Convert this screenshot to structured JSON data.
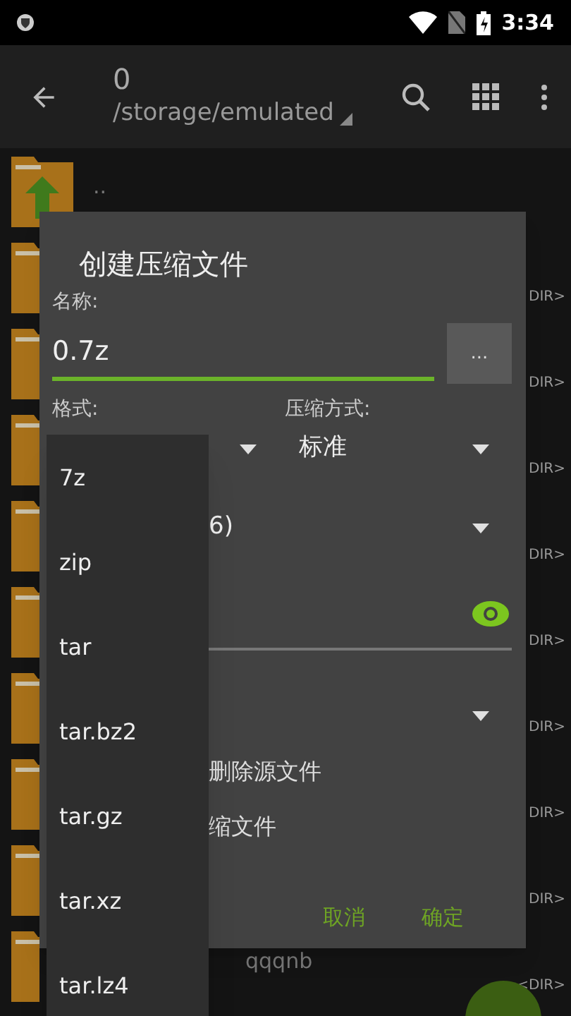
{
  "status_bar": {
    "time": "3:34"
  },
  "toolbar": {
    "title": "0",
    "path": "/storage/emulated"
  },
  "file_list": {
    "rows": [
      {
        "name": ".."
      },
      {
        "size": "DIR>"
      },
      {
        "size": "DIR>"
      },
      {
        "size": "DIR>"
      },
      {
        "size": "DIR>"
      },
      {
        "size": "DIR>"
      },
      {
        "size": "DIR>"
      },
      {
        "size": "DIR>"
      },
      {
        "size": "DIR>"
      },
      {
        "name": "qqqnb",
        "size": "<DIR>"
      }
    ]
  },
  "dialog": {
    "title": "创建压缩文件",
    "name_label": "名称:",
    "name_value": "0.7z",
    "browse_button": "...",
    "format_label": "格式:",
    "method_label": "压缩方式:",
    "method_value": "标准",
    "row_3_value": "6)",
    "options": [
      "删除源文件",
      "缩文件"
    ],
    "buttons": [
      "取消",
      "确定"
    ]
  },
  "format_menu": {
    "items": [
      "7z",
      "zip",
      "tar",
      "tar.bz2",
      "tar.gz",
      "tar.xz",
      "tar.lz4"
    ]
  }
}
